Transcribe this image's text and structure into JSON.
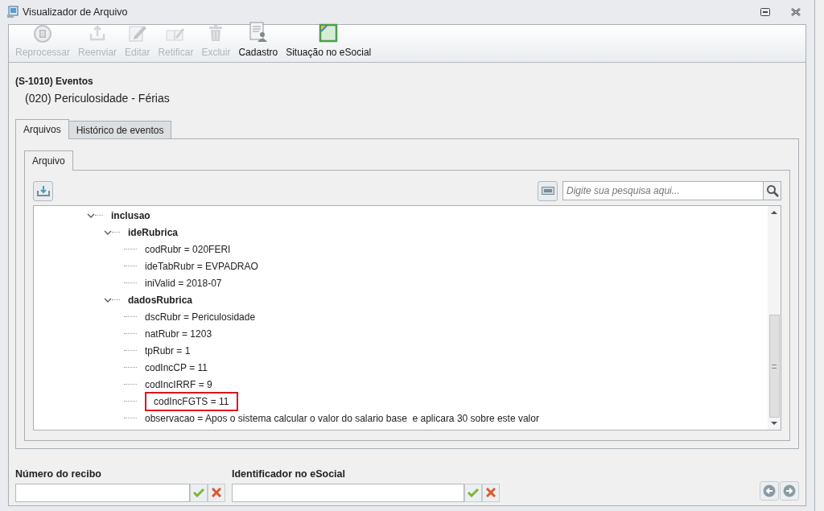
{
  "window": {
    "title": "Visualizador de Arquivo"
  },
  "toolbar": [
    {
      "label": "Reprocessar",
      "disabled": true,
      "kind": "reprocess"
    },
    {
      "label": "Reenviar",
      "disabled": true,
      "kind": "upload"
    },
    {
      "label": "Editar",
      "disabled": true,
      "kind": "edit"
    },
    {
      "label": "Retificar",
      "disabled": true,
      "kind": "rectify"
    },
    {
      "label": "Excluir",
      "disabled": true,
      "kind": "delete"
    },
    {
      "label": "Cadastro",
      "disabled": false,
      "kind": "register"
    },
    {
      "label": "Situação no eSocial",
      "disabled": false,
      "kind": "status"
    }
  ],
  "header": {
    "title": "(S-1010) Eventos",
    "subtitle": "(020) Periculosidade - Férias"
  },
  "tabs": [
    {
      "label": "Arquivos",
      "selected": true
    },
    {
      "label": "Histórico de eventos",
      "selected": false
    }
  ],
  "inner_tabs": [
    {
      "label": "Arquivo",
      "selected": true
    }
  ],
  "search": {
    "placeholder": "Digite sua pesquisa aqui..."
  },
  "tree": [
    {
      "label": "inclusao",
      "expanded": true,
      "highlighted": false,
      "children": [
        {
          "label": "ideRubrica",
          "expanded": true,
          "highlighted": false,
          "children": [
            {
              "label": "codRubr = 020FERI",
              "highlighted": false
            },
            {
              "label": "ideTabRubr = EVPADRAO",
              "highlighted": false
            },
            {
              "label": "iniValid = 2018-07",
              "highlighted": false
            }
          ]
        },
        {
          "label": "dadosRubrica",
          "expanded": true,
          "highlighted": false,
          "children": [
            {
              "label": "dscRubr = Periculosidade",
              "highlighted": false
            },
            {
              "label": "natRubr = 1203",
              "highlighted": false
            },
            {
              "label": "tpRubr = 1",
              "highlighted": false
            },
            {
              "label": "codIncCP = 11",
              "highlighted": false
            },
            {
              "label": "codIncIRRF = 9",
              "highlighted": false
            },
            {
              "label": "codIncFGTS = 11",
              "highlighted": true
            },
            {
              "label": "observacao = Apos o sistema calcular o valor do salario base  e aplicara 30 sobre este valor",
              "highlighted": false
            }
          ]
        }
      ]
    }
  ],
  "fields": [
    {
      "label": "Número do recibo"
    },
    {
      "label": "Identificador no eSocial"
    }
  ]
}
